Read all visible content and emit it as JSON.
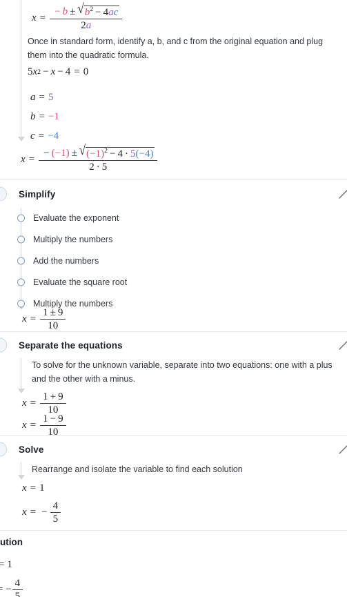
{
  "document": {
    "type": "step-by-step-math-solution",
    "equation": "5x^2 - x - 4 = 0"
  },
  "intro": {
    "quadratic_formula": {
      "lhs": "x",
      "eq": "=",
      "numerator_prefix": "−",
      "b": "b",
      "plusminus": "±",
      "radicand_b": "b",
      "exponent": "2",
      "minus": "−",
      "four": "4",
      "a": "a",
      "c": "c",
      "denominator_two": "2",
      "denominator_a": "a"
    },
    "description": "Once in standard form, identify a, b, and c from the original equation and plug them into the quadratic formula.",
    "standard_form": {
      "coef": "5",
      "x": "x",
      "power": "2",
      "minus1": "−",
      "term_x": "x",
      "minus2": "−",
      "const": "4",
      "eq": "=",
      "zero": "0"
    },
    "coefficients": [
      {
        "name": "a",
        "eq": "=",
        "value": "5",
        "color_key": "a"
      },
      {
        "name": "b",
        "eq": "=",
        "value": "−1",
        "color_key": "b"
      },
      {
        "name": "c",
        "eq": "=",
        "value": "−4",
        "color_key": "c"
      }
    ],
    "substituted": {
      "lhs": "x",
      "eq": "=",
      "minus": "−",
      "b_sub": "(−1)",
      "plusminus": "±",
      "rad_b_sub": "(−1)",
      "exponent": "2",
      "minus2": "−",
      "four": "4",
      "dot": "·",
      "a_sub": "5",
      "c_sub": "(−4)",
      "den_two": "2",
      "den_dot": "·",
      "den_a": "5"
    }
  },
  "sections": [
    {
      "id": "simplify",
      "title": "Simplify",
      "collapse_icon": "chevron-collapse-icon",
      "steps": [
        "Evaluate the exponent",
        "Multiply the numbers",
        "Add the numbers",
        "Evaluate the square root",
        "Multiply the numbers"
      ],
      "result": {
        "lhs": "x",
        "eq": "=",
        "num_left": "1",
        "num_op": "±",
        "num_right": "9",
        "den": "10"
      }
    },
    {
      "id": "separate-the-equations",
      "title": "Separate the equations",
      "collapse_icon": "chevron-collapse-icon",
      "description": "To solve for the unknown variable, separate into two equations: one with a plus and the other with a minus.",
      "results": [
        {
          "lhs": "x",
          "eq": "=",
          "num_left": "1",
          "num_op": "+",
          "num_right": "9",
          "den": "10"
        },
        {
          "lhs": "x",
          "eq": "=",
          "num_left": "1",
          "num_op": "−",
          "num_right": "9",
          "den": "10"
        }
      ]
    },
    {
      "id": "solve",
      "title": "Solve",
      "collapse_icon": "chevron-collapse-icon",
      "description": "Rearrange and isolate the variable to find each solution",
      "results": [
        {
          "lhs": "x",
          "eq": "=",
          "value": "1",
          "is_fraction": false
        },
        {
          "lhs": "x",
          "eq": "=",
          "sign": "−",
          "num": "4",
          "den": "5",
          "is_fraction": true
        }
      ]
    }
  ],
  "footer": {
    "title_clipped": "ution",
    "results": [
      {
        "eq": "= 1"
      },
      {
        "eq_sign": "= −",
        "num": "4",
        "den": "5"
      }
    ]
  },
  "colors": {
    "var_a": "#8b5fbf",
    "var_b": "#d94f6e",
    "var_c": "#4a7fd4",
    "text": "#33383d",
    "heading": "#1f2429",
    "divider": "#e6e8ea",
    "connector": "#d2d6da",
    "bullet_ring": "#7d9bc1",
    "section_bullet": "#c8d6e8",
    "background": "#ffffff"
  }
}
